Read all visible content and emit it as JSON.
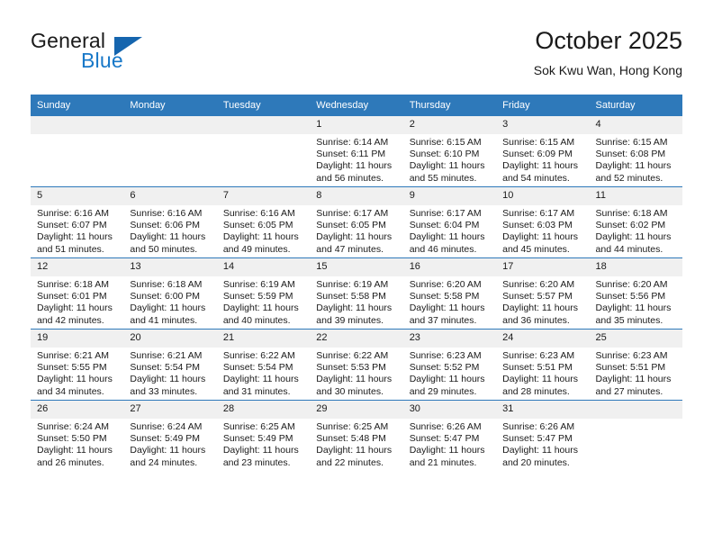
{
  "brand": {
    "name_top": "General",
    "name_bottom": "Blue",
    "accent_color": "#1878c8",
    "triangle_color": "#1565ae"
  },
  "header": {
    "title": "October 2025",
    "subtitle": "Sok Kwu Wan, Hong Kong"
  },
  "calendar": {
    "header_color": "#2e79ba",
    "daynum_background": "#f0f0f0",
    "weekdays": [
      "Sunday",
      "Monday",
      "Tuesday",
      "Wednesday",
      "Thursday",
      "Friday",
      "Saturday"
    ],
    "labels": {
      "sunrise": "Sunrise:",
      "sunset": "Sunset:",
      "daylight": "Daylight:"
    },
    "weeks": [
      [
        {
          "day": "",
          "blank": true
        },
        {
          "day": "",
          "blank": true
        },
        {
          "day": "",
          "blank": true
        },
        {
          "day": "1",
          "sunrise": "Sunrise: 6:14 AM",
          "sunset": "Sunset: 6:11 PM",
          "daylight_1": "Daylight: 11 hours",
          "daylight_2": "and 56 minutes."
        },
        {
          "day": "2",
          "sunrise": "Sunrise: 6:15 AM",
          "sunset": "Sunset: 6:10 PM",
          "daylight_1": "Daylight: 11 hours",
          "daylight_2": "and 55 minutes."
        },
        {
          "day": "3",
          "sunrise": "Sunrise: 6:15 AM",
          "sunset": "Sunset: 6:09 PM",
          "daylight_1": "Daylight: 11 hours",
          "daylight_2": "and 54 minutes."
        },
        {
          "day": "4",
          "sunrise": "Sunrise: 6:15 AM",
          "sunset": "Sunset: 6:08 PM",
          "daylight_1": "Daylight: 11 hours",
          "daylight_2": "and 52 minutes."
        }
      ],
      [
        {
          "day": "5",
          "sunrise": "Sunrise: 6:16 AM",
          "sunset": "Sunset: 6:07 PM",
          "daylight_1": "Daylight: 11 hours",
          "daylight_2": "and 51 minutes."
        },
        {
          "day": "6",
          "sunrise": "Sunrise: 6:16 AM",
          "sunset": "Sunset: 6:06 PM",
          "daylight_1": "Daylight: 11 hours",
          "daylight_2": "and 50 minutes."
        },
        {
          "day": "7",
          "sunrise": "Sunrise: 6:16 AM",
          "sunset": "Sunset: 6:05 PM",
          "daylight_1": "Daylight: 11 hours",
          "daylight_2": "and 49 minutes."
        },
        {
          "day": "8",
          "sunrise": "Sunrise: 6:17 AM",
          "sunset": "Sunset: 6:05 PM",
          "daylight_1": "Daylight: 11 hours",
          "daylight_2": "and 47 minutes."
        },
        {
          "day": "9",
          "sunrise": "Sunrise: 6:17 AM",
          "sunset": "Sunset: 6:04 PM",
          "daylight_1": "Daylight: 11 hours",
          "daylight_2": "and 46 minutes."
        },
        {
          "day": "10",
          "sunrise": "Sunrise: 6:17 AM",
          "sunset": "Sunset: 6:03 PM",
          "daylight_1": "Daylight: 11 hours",
          "daylight_2": "and 45 minutes."
        },
        {
          "day": "11",
          "sunrise": "Sunrise: 6:18 AM",
          "sunset": "Sunset: 6:02 PM",
          "daylight_1": "Daylight: 11 hours",
          "daylight_2": "and 44 minutes."
        }
      ],
      [
        {
          "day": "12",
          "sunrise": "Sunrise: 6:18 AM",
          "sunset": "Sunset: 6:01 PM",
          "daylight_1": "Daylight: 11 hours",
          "daylight_2": "and 42 minutes."
        },
        {
          "day": "13",
          "sunrise": "Sunrise: 6:18 AM",
          "sunset": "Sunset: 6:00 PM",
          "daylight_1": "Daylight: 11 hours",
          "daylight_2": "and 41 minutes."
        },
        {
          "day": "14",
          "sunrise": "Sunrise: 6:19 AM",
          "sunset": "Sunset: 5:59 PM",
          "daylight_1": "Daylight: 11 hours",
          "daylight_2": "and 40 minutes."
        },
        {
          "day": "15",
          "sunrise": "Sunrise: 6:19 AM",
          "sunset": "Sunset: 5:58 PM",
          "daylight_1": "Daylight: 11 hours",
          "daylight_2": "and 39 minutes."
        },
        {
          "day": "16",
          "sunrise": "Sunrise: 6:20 AM",
          "sunset": "Sunset: 5:58 PM",
          "daylight_1": "Daylight: 11 hours",
          "daylight_2": "and 37 minutes."
        },
        {
          "day": "17",
          "sunrise": "Sunrise: 6:20 AM",
          "sunset": "Sunset: 5:57 PM",
          "daylight_1": "Daylight: 11 hours",
          "daylight_2": "and 36 minutes."
        },
        {
          "day": "18",
          "sunrise": "Sunrise: 6:20 AM",
          "sunset": "Sunset: 5:56 PM",
          "daylight_1": "Daylight: 11 hours",
          "daylight_2": "and 35 minutes."
        }
      ],
      [
        {
          "day": "19",
          "sunrise": "Sunrise: 6:21 AM",
          "sunset": "Sunset: 5:55 PM",
          "daylight_1": "Daylight: 11 hours",
          "daylight_2": "and 34 minutes."
        },
        {
          "day": "20",
          "sunrise": "Sunrise: 6:21 AM",
          "sunset": "Sunset: 5:54 PM",
          "daylight_1": "Daylight: 11 hours",
          "daylight_2": "and 33 minutes."
        },
        {
          "day": "21",
          "sunrise": "Sunrise: 6:22 AM",
          "sunset": "Sunset: 5:54 PM",
          "daylight_1": "Daylight: 11 hours",
          "daylight_2": "and 31 minutes."
        },
        {
          "day": "22",
          "sunrise": "Sunrise: 6:22 AM",
          "sunset": "Sunset: 5:53 PM",
          "daylight_1": "Daylight: 11 hours",
          "daylight_2": "and 30 minutes."
        },
        {
          "day": "23",
          "sunrise": "Sunrise: 6:23 AM",
          "sunset": "Sunset: 5:52 PM",
          "daylight_1": "Daylight: 11 hours",
          "daylight_2": "and 29 minutes."
        },
        {
          "day": "24",
          "sunrise": "Sunrise: 6:23 AM",
          "sunset": "Sunset: 5:51 PM",
          "daylight_1": "Daylight: 11 hours",
          "daylight_2": "and 28 minutes."
        },
        {
          "day": "25",
          "sunrise": "Sunrise: 6:23 AM",
          "sunset": "Sunset: 5:51 PM",
          "daylight_1": "Daylight: 11 hours",
          "daylight_2": "and 27 minutes."
        }
      ],
      [
        {
          "day": "26",
          "sunrise": "Sunrise: 6:24 AM",
          "sunset": "Sunset: 5:50 PM",
          "daylight_1": "Daylight: 11 hours",
          "daylight_2": "and 26 minutes."
        },
        {
          "day": "27",
          "sunrise": "Sunrise: 6:24 AM",
          "sunset": "Sunset: 5:49 PM",
          "daylight_1": "Daylight: 11 hours",
          "daylight_2": "and 24 minutes."
        },
        {
          "day": "28",
          "sunrise": "Sunrise: 6:25 AM",
          "sunset": "Sunset: 5:49 PM",
          "daylight_1": "Daylight: 11 hours",
          "daylight_2": "and 23 minutes."
        },
        {
          "day": "29",
          "sunrise": "Sunrise: 6:25 AM",
          "sunset": "Sunset: 5:48 PM",
          "daylight_1": "Daylight: 11 hours",
          "daylight_2": "and 22 minutes."
        },
        {
          "day": "30",
          "sunrise": "Sunrise: 6:26 AM",
          "sunset": "Sunset: 5:47 PM",
          "daylight_1": "Daylight: 11 hours",
          "daylight_2": "and 21 minutes."
        },
        {
          "day": "31",
          "sunrise": "Sunrise: 6:26 AM",
          "sunset": "Sunset: 5:47 PM",
          "daylight_1": "Daylight: 11 hours",
          "daylight_2": "and 20 minutes."
        },
        {
          "day": "",
          "blank": true
        }
      ]
    ]
  }
}
